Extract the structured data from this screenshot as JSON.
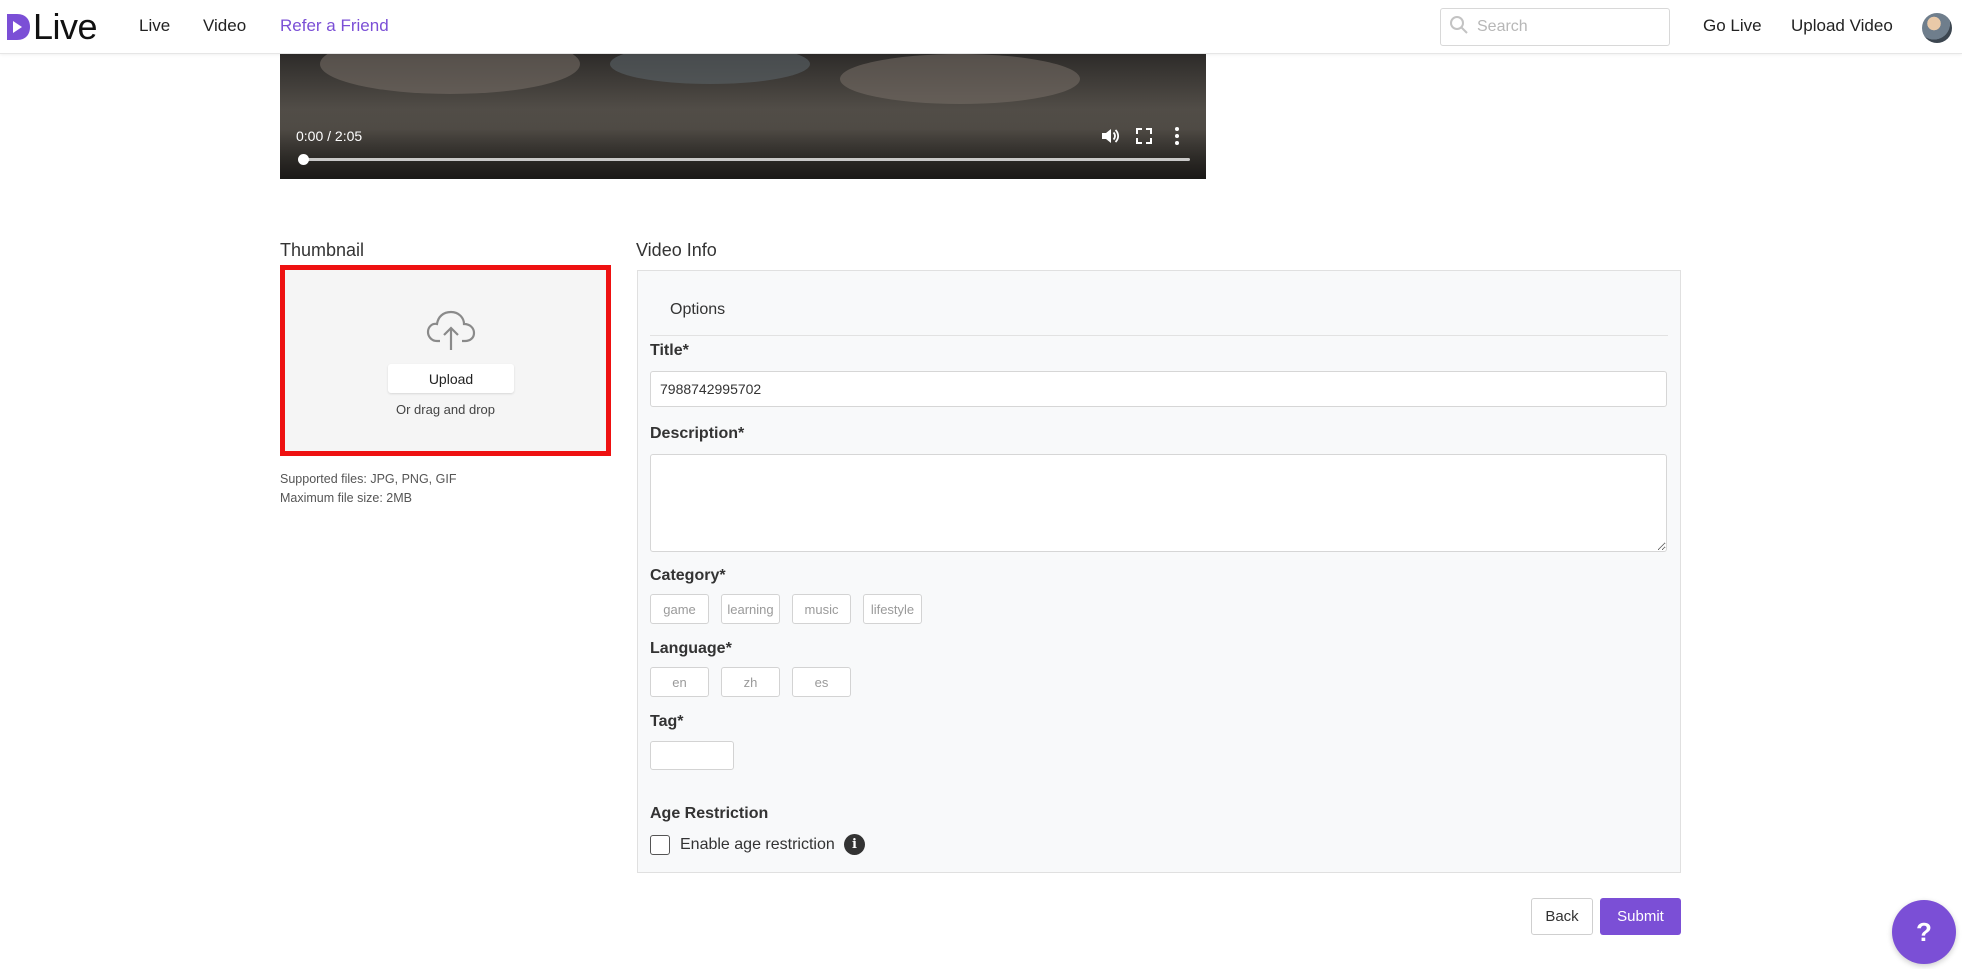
{
  "header": {
    "logo_text": "Live",
    "nav": [
      "Live",
      "Video",
      "Refer a Friend"
    ],
    "search_placeholder": "Search",
    "go_live": "Go Live",
    "upload_video": "Upload Video"
  },
  "video_player": {
    "time_display": "0:00 / 2:05",
    "progress": 0
  },
  "thumbnail": {
    "heading": "Thumbnail",
    "upload_label": "Upload",
    "drag_hint": "Or drag and drop",
    "supported_files": "Supported files: JPG, PNG, GIF",
    "max_size": "Maximum file size: 2MB"
  },
  "video_info": {
    "heading": "Video Info",
    "tab": "Options",
    "title_label": "Title*",
    "title_value": "7988742995702",
    "description_label": "Description*",
    "description_value": "",
    "category_label": "Category*",
    "categories": [
      "game",
      "learning",
      "music",
      "lifestyle"
    ],
    "language_label": "Language*",
    "languages": [
      "en",
      "zh",
      "es"
    ],
    "tag_label": "Tag*",
    "age_heading": "Age Restriction",
    "age_checkbox_label": "Enable age restriction",
    "age_checked": false
  },
  "actions": {
    "back": "Back",
    "submit": "Submit",
    "help": "?"
  },
  "colors": {
    "accent": "#7b4fd6",
    "highlight_border": "#ee1111"
  }
}
